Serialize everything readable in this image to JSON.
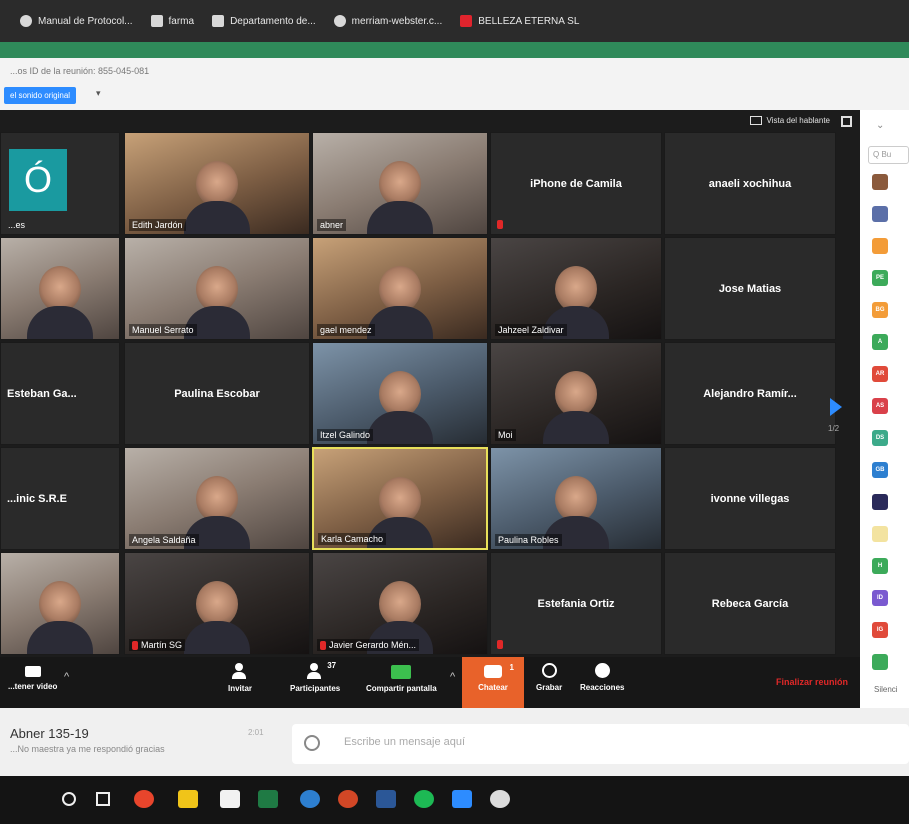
{
  "bookmarks": [
    {
      "label": "Manual de Protocol...",
      "icon": "globe-icon"
    },
    {
      "label": "farma",
      "icon": "bookmark-icon"
    },
    {
      "label": "Departamento de...",
      "icon": "bookmark-icon"
    },
    {
      "label": "merriam-webster.c...",
      "icon": "globe-icon"
    },
    {
      "label": "BELLEZA ETERNA SL",
      "icon": "youtube-icon"
    }
  ],
  "meeting": {
    "id_text": "...os ID de la reunión: 855-045-081",
    "original_sound": "el sonido original",
    "speaker_view": "Vista del hablante",
    "page": "1/2"
  },
  "participants": [
    {
      "name": "...es",
      "avatar_letter": "Ó",
      "mode": "avatar"
    },
    {
      "name": "Edith Jardón",
      "mode": "video"
    },
    {
      "name": "abner",
      "mode": "video"
    },
    {
      "name": "iPhone de Camila",
      "mode": "name"
    },
    {
      "name": "anaeli xochihua",
      "mode": "name"
    },
    {
      "name": "",
      "mode": "video"
    },
    {
      "name": "Manuel Serrato",
      "mode": "video"
    },
    {
      "name": "gael mendez",
      "mode": "video"
    },
    {
      "name": "Jahzeel Zaldivar",
      "mode": "video"
    },
    {
      "name": "Jose Matias",
      "mode": "name"
    },
    {
      "name": "Esteban Ga...",
      "mode": "name"
    },
    {
      "name": "Paulina Escobar",
      "mode": "name"
    },
    {
      "name": "Itzel Galindo",
      "mode": "video"
    },
    {
      "name": "Moi",
      "mode": "video"
    },
    {
      "name": "Alejandro  Ramír...",
      "mode": "name"
    },
    {
      "name": "...inic S.R.E",
      "mode": "name"
    },
    {
      "name": "Angela Saldaña",
      "mode": "video"
    },
    {
      "name": "Karla Camacho",
      "mode": "video"
    },
    {
      "name": "Paulina Robles",
      "mode": "video"
    },
    {
      "name": "ivonne villegas",
      "mode": "name"
    },
    {
      "name": "",
      "mode": "video"
    },
    {
      "name": "Martín SG",
      "mode": "video"
    },
    {
      "name": "Javier Gerardo Mén...",
      "mode": "video"
    },
    {
      "name": "Estefania Ortiz",
      "mode": "name"
    },
    {
      "name": "Rebeca García",
      "mode": "name"
    }
  ],
  "toolbar": {
    "video": "...tener video",
    "invite": "Invitar",
    "participants": "Participantes",
    "participants_count": "37",
    "share": "Compartir pantalla",
    "chat": "Chatear",
    "chat_count": "1",
    "record": "Grabar",
    "reactions": "Reacciones",
    "end": "Finalizar reunión"
  },
  "panel": {
    "search": "Q Bu",
    "footer": "Silenci",
    "avatars": [
      {
        "initials": "",
        "color": "#8b5a3c"
      },
      {
        "initials": "",
        "color": "#5b6fa8"
      },
      {
        "initials": "",
        "color": "#f39c38"
      },
      {
        "initials": "PE",
        "color": "#3caa5a"
      },
      {
        "initials": "BG",
        "color": "#f39c38"
      },
      {
        "initials": "A",
        "color": "#3caa5a"
      },
      {
        "initials": "AR",
        "color": "#e04a3a"
      },
      {
        "initials": "AS",
        "color": "#d9414a"
      },
      {
        "initials": "DS",
        "color": "#3caa8a"
      },
      {
        "initials": "GB",
        "color": "#2d7fd0"
      },
      {
        "initials": "",
        "color": "#2a2a5a"
      },
      {
        "initials": "",
        "color": "#f3e3a0"
      },
      {
        "initials": "H",
        "color": "#3caa5a"
      },
      {
        "initials": "ID",
        "color": "#7a5ad0"
      },
      {
        "initials": "IG",
        "color": "#e04a3a"
      },
      {
        "initials": "",
        "color": "#3caa5a"
      }
    ]
  },
  "chat_contact": {
    "name": "Abner 135-19",
    "preview": "...No maestra ya me respondió gracias",
    "time": "2:01"
  },
  "message_input": {
    "placeholder": "Escribe un mensaje aquí"
  },
  "colors": {
    "accent_green": "#2f8a5a",
    "zoom_blue": "#2d8cff",
    "chat_orange": "#e8622a",
    "end_red": "#e02828",
    "active_border": "#e8e05a"
  }
}
